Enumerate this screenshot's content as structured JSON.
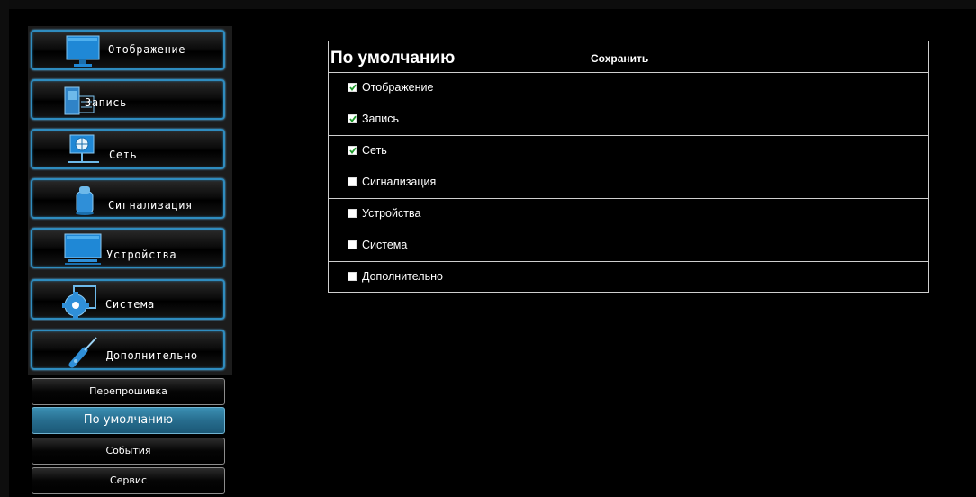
{
  "sidebar": {
    "main_items": [
      {
        "label": "Отображение",
        "icon": "monitor-icon"
      },
      {
        "label": "Запись",
        "icon": "record-icon"
      },
      {
        "label": "Сеть",
        "icon": "network-icon"
      },
      {
        "label": "Сигнализация",
        "icon": "alarm-icon"
      },
      {
        "label": "Устройства",
        "icon": "devices-icon"
      },
      {
        "label": "Система",
        "icon": "gear-icon"
      },
      {
        "label": "Дополнительно",
        "icon": "screwdriver-icon"
      }
    ],
    "sub_items": [
      {
        "label": "Перепрошивка",
        "active": false
      },
      {
        "label": "По умолчанию",
        "active": true
      },
      {
        "label": "События",
        "active": false
      },
      {
        "label": "Сервис",
        "active": false
      }
    ]
  },
  "panel": {
    "title": "По умолчанию",
    "save_label": "Сохранить",
    "rows": [
      {
        "label": "Отображение",
        "checked": true
      },
      {
        "label": "Запись",
        "checked": true
      },
      {
        "label": "Сеть",
        "checked": true
      },
      {
        "label": "Сигнализация",
        "checked": false
      },
      {
        "label": "Устройства",
        "checked": false
      },
      {
        "label": "Система",
        "checked": false
      },
      {
        "label": "Дополнительно",
        "checked": false
      }
    ]
  },
  "colors": {
    "accent": "#2f8cbf",
    "active_sub": "#276d8e",
    "check_green": "#1f9a2c"
  }
}
